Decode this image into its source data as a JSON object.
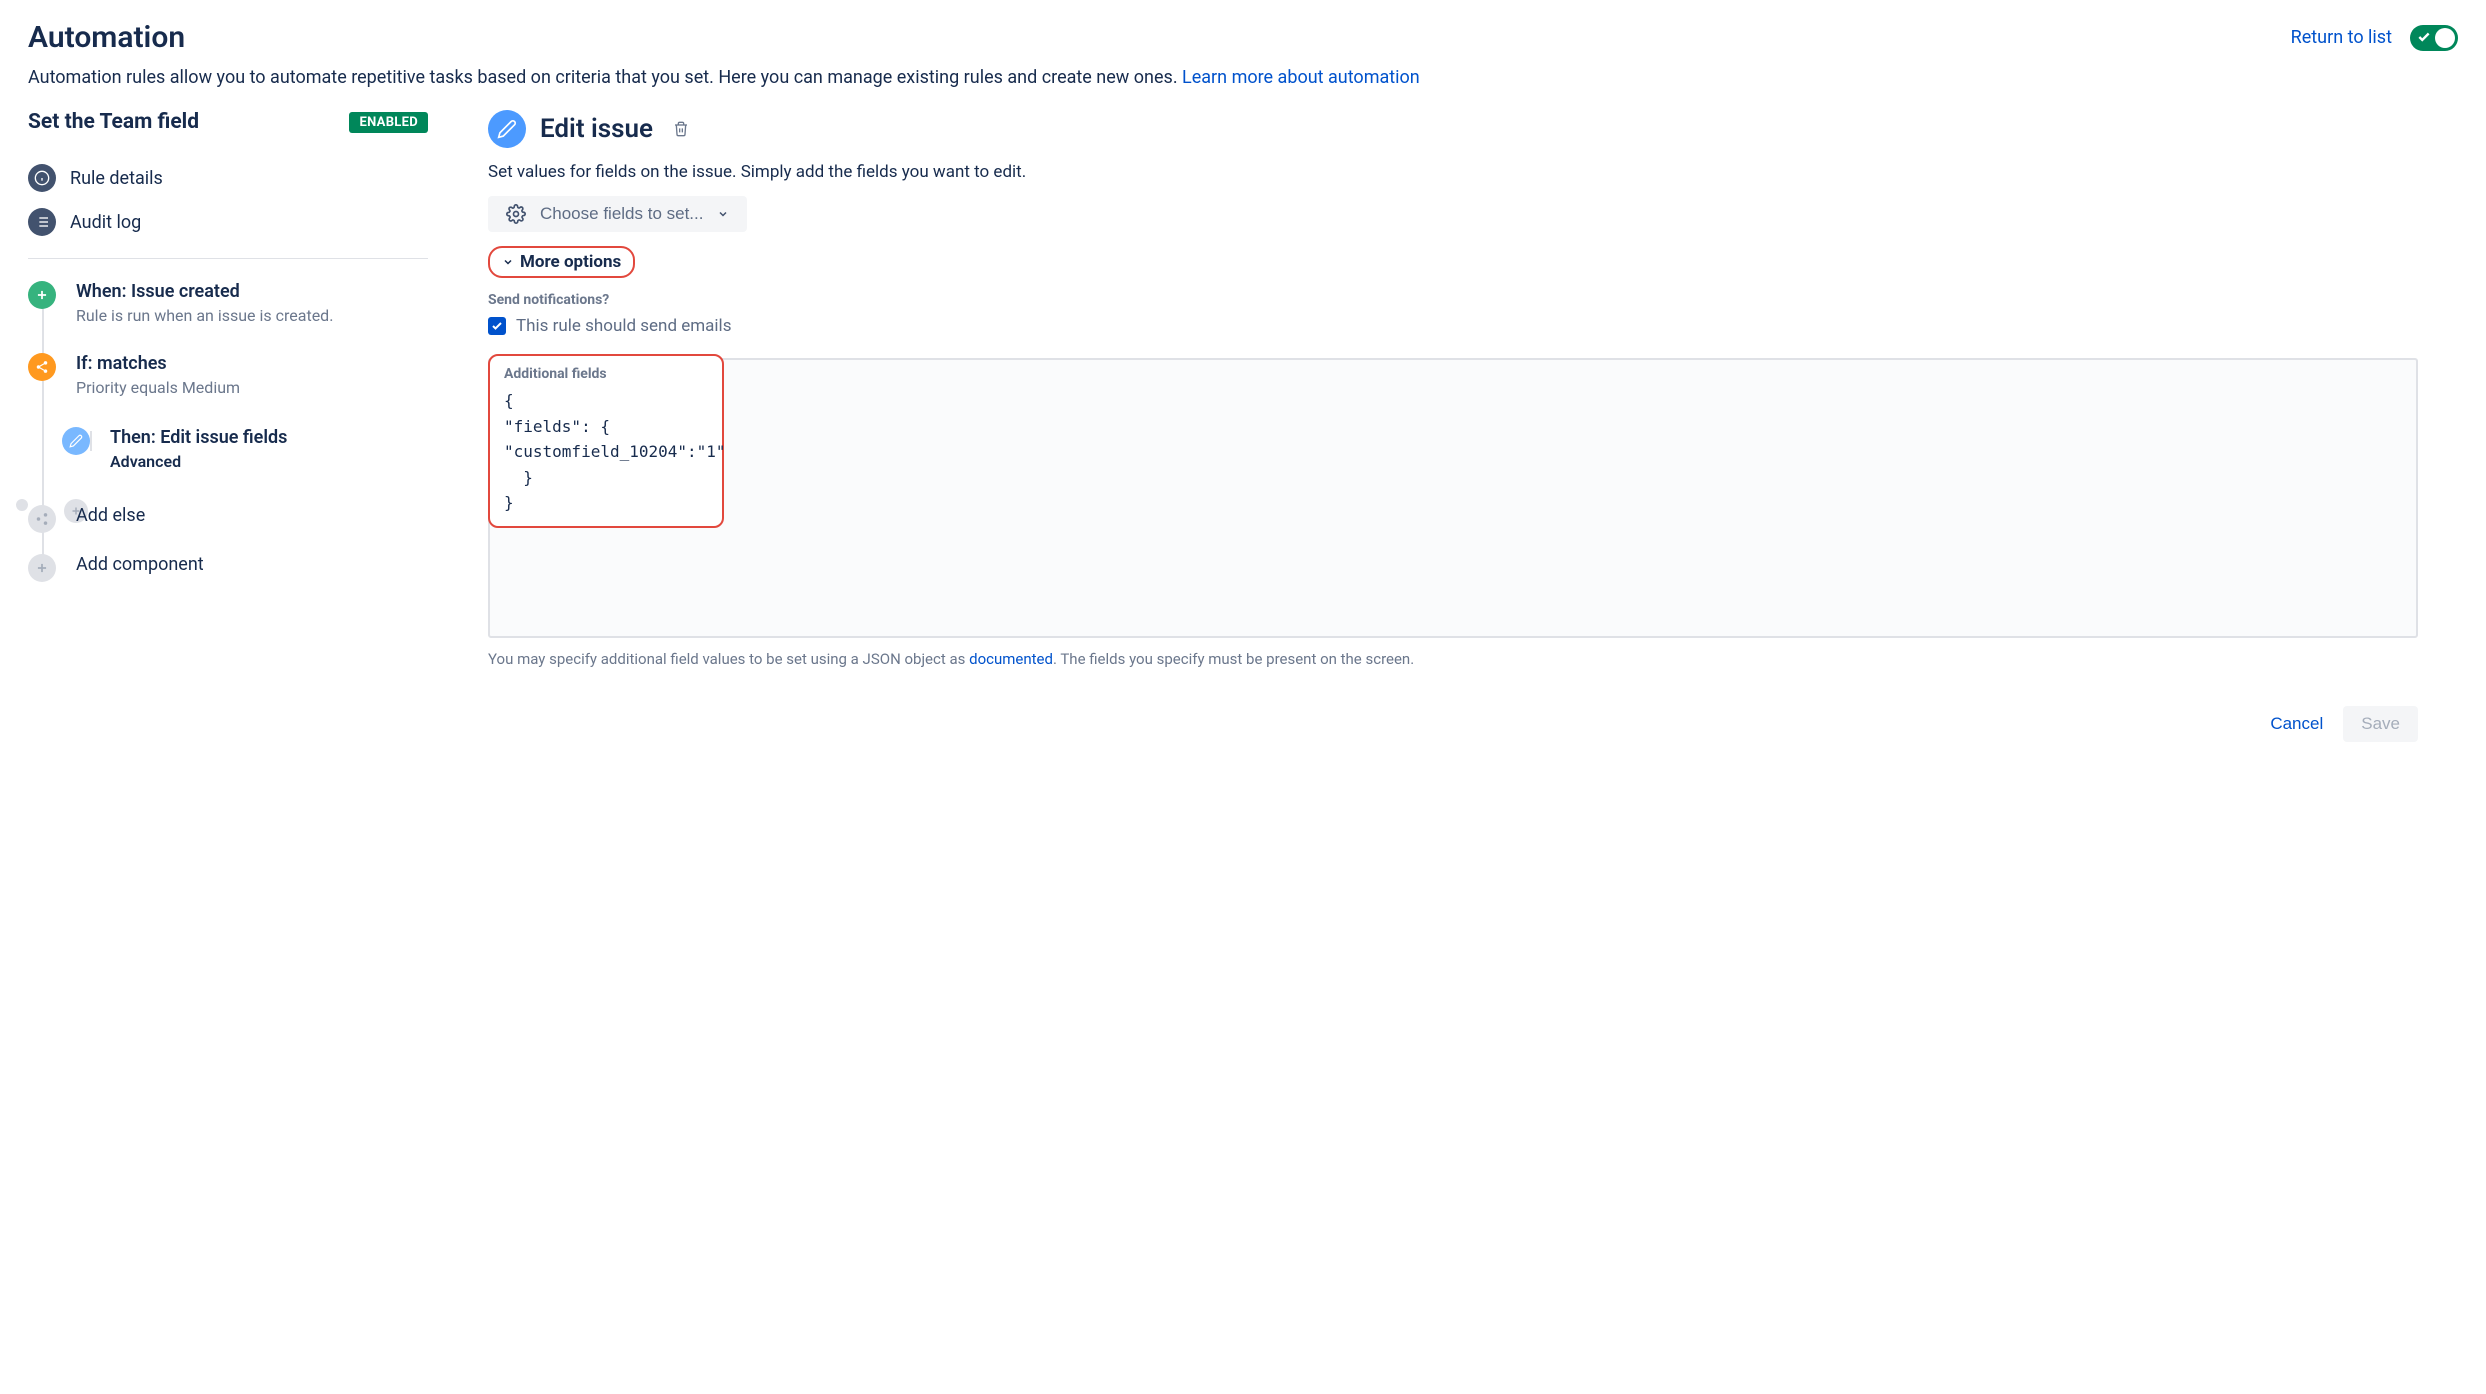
{
  "header": {
    "title": "Automation",
    "return_link": "Return to list",
    "intro_prefix": "Automation rules allow you to automate repetitive tasks based on criteria that you set. Here you can manage existing rules and create new ones. ",
    "intro_link": "Learn more about automation"
  },
  "rule": {
    "name": "Set the Team field",
    "status": "ENABLED",
    "nav": {
      "details": "Rule details",
      "audit": "Audit log"
    },
    "steps": {
      "trigger": {
        "title": "When: Issue created",
        "sub": "Rule is run when an issue is created."
      },
      "condition": {
        "title": "If: matches",
        "sub": "Priority equals Medium"
      },
      "action": {
        "title": "Then: Edit issue fields",
        "sub": "Advanced"
      },
      "addElse": "Add else",
      "addComponent": "Add component"
    }
  },
  "panel": {
    "title": "Edit issue",
    "desc": "Set values for fields on the issue. Simply add the fields you want to edit.",
    "choose_fields": "Choose fields to set...",
    "more_options": "More options",
    "send_notifications_label": "Send notifications?",
    "send_emails": "This rule should send emails",
    "additional_fields_label": "Additional fields",
    "additional_fields_code": "{\n\"fields\": {\n\"customfield_10204\":\"1\"\n  }\n}",
    "help_prefix": "You may specify additional field values to be set using a JSON object as ",
    "help_link": "documented",
    "help_suffix": ". The fields you specify must be present on the screen.",
    "cancel": "Cancel",
    "save": "Save"
  }
}
